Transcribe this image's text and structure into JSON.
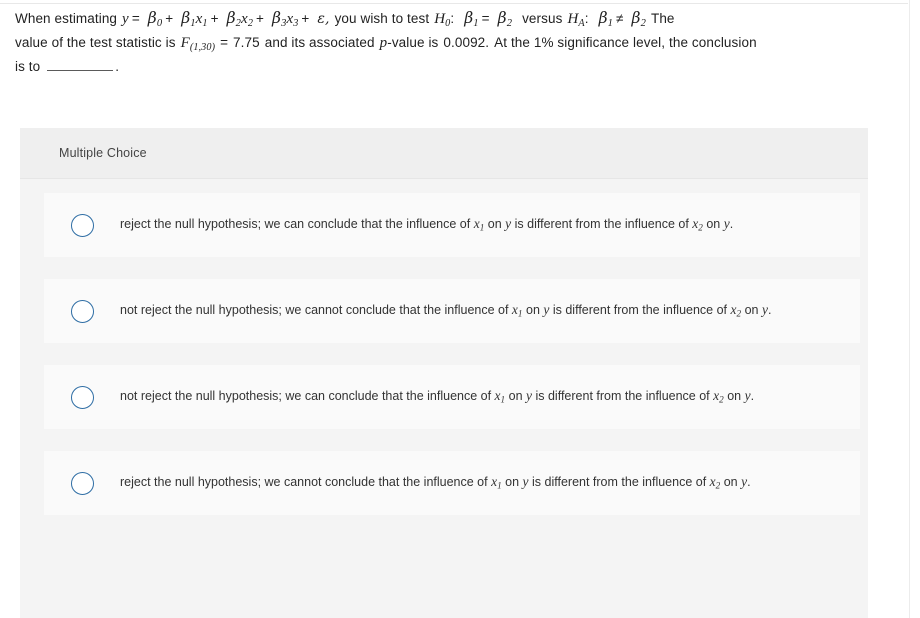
{
  "question": {
    "line1": {
      "intro": "When estimating",
      "y": "y",
      "eq": "=",
      "b0": "β",
      "b0sub": "0",
      "plus1": "+",
      "b1": "β",
      "b1sub": "1",
      "x1": "x",
      "x1sub": "1",
      "plus2": "+",
      "b2": "β",
      "b2sub": "2",
      "x2": "x",
      "x2sub": "2",
      "plus3": "+",
      "b3": "β",
      "b3sub": "3",
      "x3": "x",
      "x3sub": "3",
      "plus4": "+",
      "epsilon": "ε,",
      "wish": "you wish to test",
      "H0": "H",
      "H0sub": "0",
      "colon1": ":",
      "hb1": "β",
      "hb1sub": "1",
      "equals": "=",
      "hb2": "β",
      "hb2sub": "2",
      "versus": "versus",
      "HA": "H",
      "HAsub": "A",
      "colon2": ":",
      "ab1": "β",
      "ab1sub": "1",
      "noteq": "≠",
      "ab2": "β",
      "ab2sub": "2",
      "tail": "The"
    },
    "line2": {
      "pre": "value of the test statistic is",
      "F": "F",
      "Fsub": "(1,30)",
      "eq": "=",
      "stat_value": "7.75",
      "mid": "and its associated",
      "p": "p",
      "pval_label": "-value is",
      "p_value": "0.0092.",
      "post": "At the 1% significance level, the conclusion"
    },
    "line3": {
      "pre": "is to",
      "period": "."
    }
  },
  "card": {
    "header_title": "Multiple Choice",
    "options": [
      {
        "id": "option-a",
        "segments": [
          {
            "t": "text",
            "v": "reject the null hypothesis; we can conclude that the influence of "
          },
          {
            "t": "var",
            "v": "x",
            "sub": "1"
          },
          {
            "t": "text",
            "v": " on "
          },
          {
            "t": "var",
            "v": "y"
          },
          {
            "t": "text",
            "v": " is different from the influence of "
          },
          {
            "t": "var",
            "v": "x",
            "sub": "2"
          },
          {
            "t": "text",
            "v": " on "
          },
          {
            "t": "var",
            "v": "y"
          },
          {
            "t": "text",
            "v": "."
          }
        ],
        "plain": "reject the null hypothesis; we can conclude that the influence of x1 on y is different from the influence of x2 on y."
      },
      {
        "id": "option-b",
        "segments": [
          {
            "t": "text",
            "v": "not reject the null hypothesis; we cannot conclude that the influence of "
          },
          {
            "t": "var",
            "v": "x",
            "sub": "1"
          },
          {
            "t": "text",
            "v": " on "
          },
          {
            "t": "var",
            "v": "y"
          },
          {
            "t": "text",
            "v": " is different from the influence of "
          },
          {
            "t": "var",
            "v": "x",
            "sub": "2"
          },
          {
            "t": "text",
            "v": " on "
          },
          {
            "t": "var",
            "v": "y"
          },
          {
            "t": "text",
            "v": "."
          }
        ],
        "plain": "not reject the null hypothesis; we cannot conclude that the influence of x1 on y is different from the influence of x2 on y."
      },
      {
        "id": "option-c",
        "segments": [
          {
            "t": "text",
            "v": "not reject the null hypothesis; we can conclude that the influence of "
          },
          {
            "t": "var",
            "v": "x",
            "sub": "1"
          },
          {
            "t": "text",
            "v": " on "
          },
          {
            "t": "var",
            "v": "y"
          },
          {
            "t": "text",
            "v": " is different from the influence of "
          },
          {
            "t": "var",
            "v": "x",
            "sub": "2"
          },
          {
            "t": "text",
            "v": " on "
          },
          {
            "t": "var",
            "v": "y"
          },
          {
            "t": "text",
            "v": "."
          }
        ],
        "plain": "not reject the null hypothesis; we can conclude that the influence of x1 on y is different from the influence of x2 on y."
      },
      {
        "id": "option-d",
        "segments": [
          {
            "t": "text",
            "v": "reject the null hypothesis; we cannot conclude that the influence of "
          },
          {
            "t": "var",
            "v": "x",
            "sub": "1"
          },
          {
            "t": "text",
            "v": " on "
          },
          {
            "t": "var",
            "v": "y"
          },
          {
            "t": "text",
            "v": " is different from the influence of "
          },
          {
            "t": "var",
            "v": "x",
            "sub": "2"
          },
          {
            "t": "text",
            "v": " on "
          },
          {
            "t": "var",
            "v": "y"
          },
          {
            "t": "text",
            "v": "."
          }
        ],
        "plain": "reject the null hypothesis; we cannot conclude that the influence of x1 on y is different from the influence of x2 on y."
      }
    ]
  },
  "colors": {
    "radio_border": "#2e6da4",
    "card_bg": "#f4f4f4",
    "card_header_bg": "#efefef",
    "option_bg": "#fafafa",
    "text": "#333333"
  }
}
